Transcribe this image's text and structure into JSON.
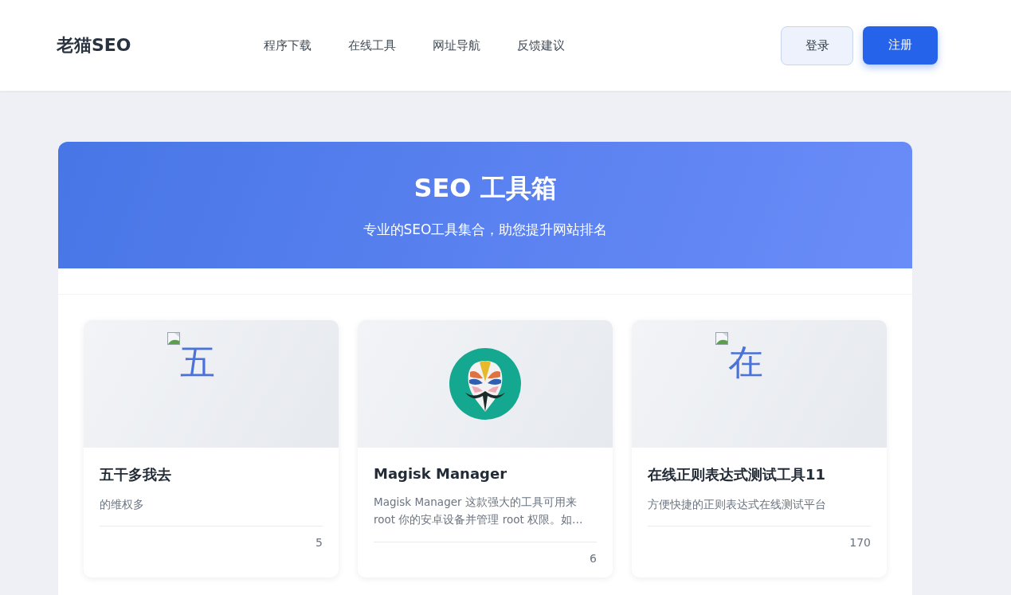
{
  "header": {
    "logo": "老猫SEO",
    "nav": [
      {
        "label": "程序下载"
      },
      {
        "label": "在线工具"
      },
      {
        "label": "网址导航"
      },
      {
        "label": "反馈建议"
      }
    ],
    "login": "登录",
    "register": "注册"
  },
  "hero": {
    "title": "SEO 工具箱",
    "subtitle": "专业的SEO工具集合，助您提升网站排名"
  },
  "cards": [
    {
      "kind": "broken",
      "alt": "五",
      "title": "五干多我去",
      "description": "的维权多",
      "count": "5"
    },
    {
      "kind": "logo",
      "title": "Magisk Manager",
      "description": "Magisk Manager 这款强大的工具可用来 root 你的安卓设备并管理 root 权限。如…",
      "count": "6"
    },
    {
      "kind": "broken",
      "alt": "在",
      "title": "在线正则表达式测试工具11",
      "description": "方便快捷的正则表达式在线测试平台",
      "count": "170"
    }
  ]
}
